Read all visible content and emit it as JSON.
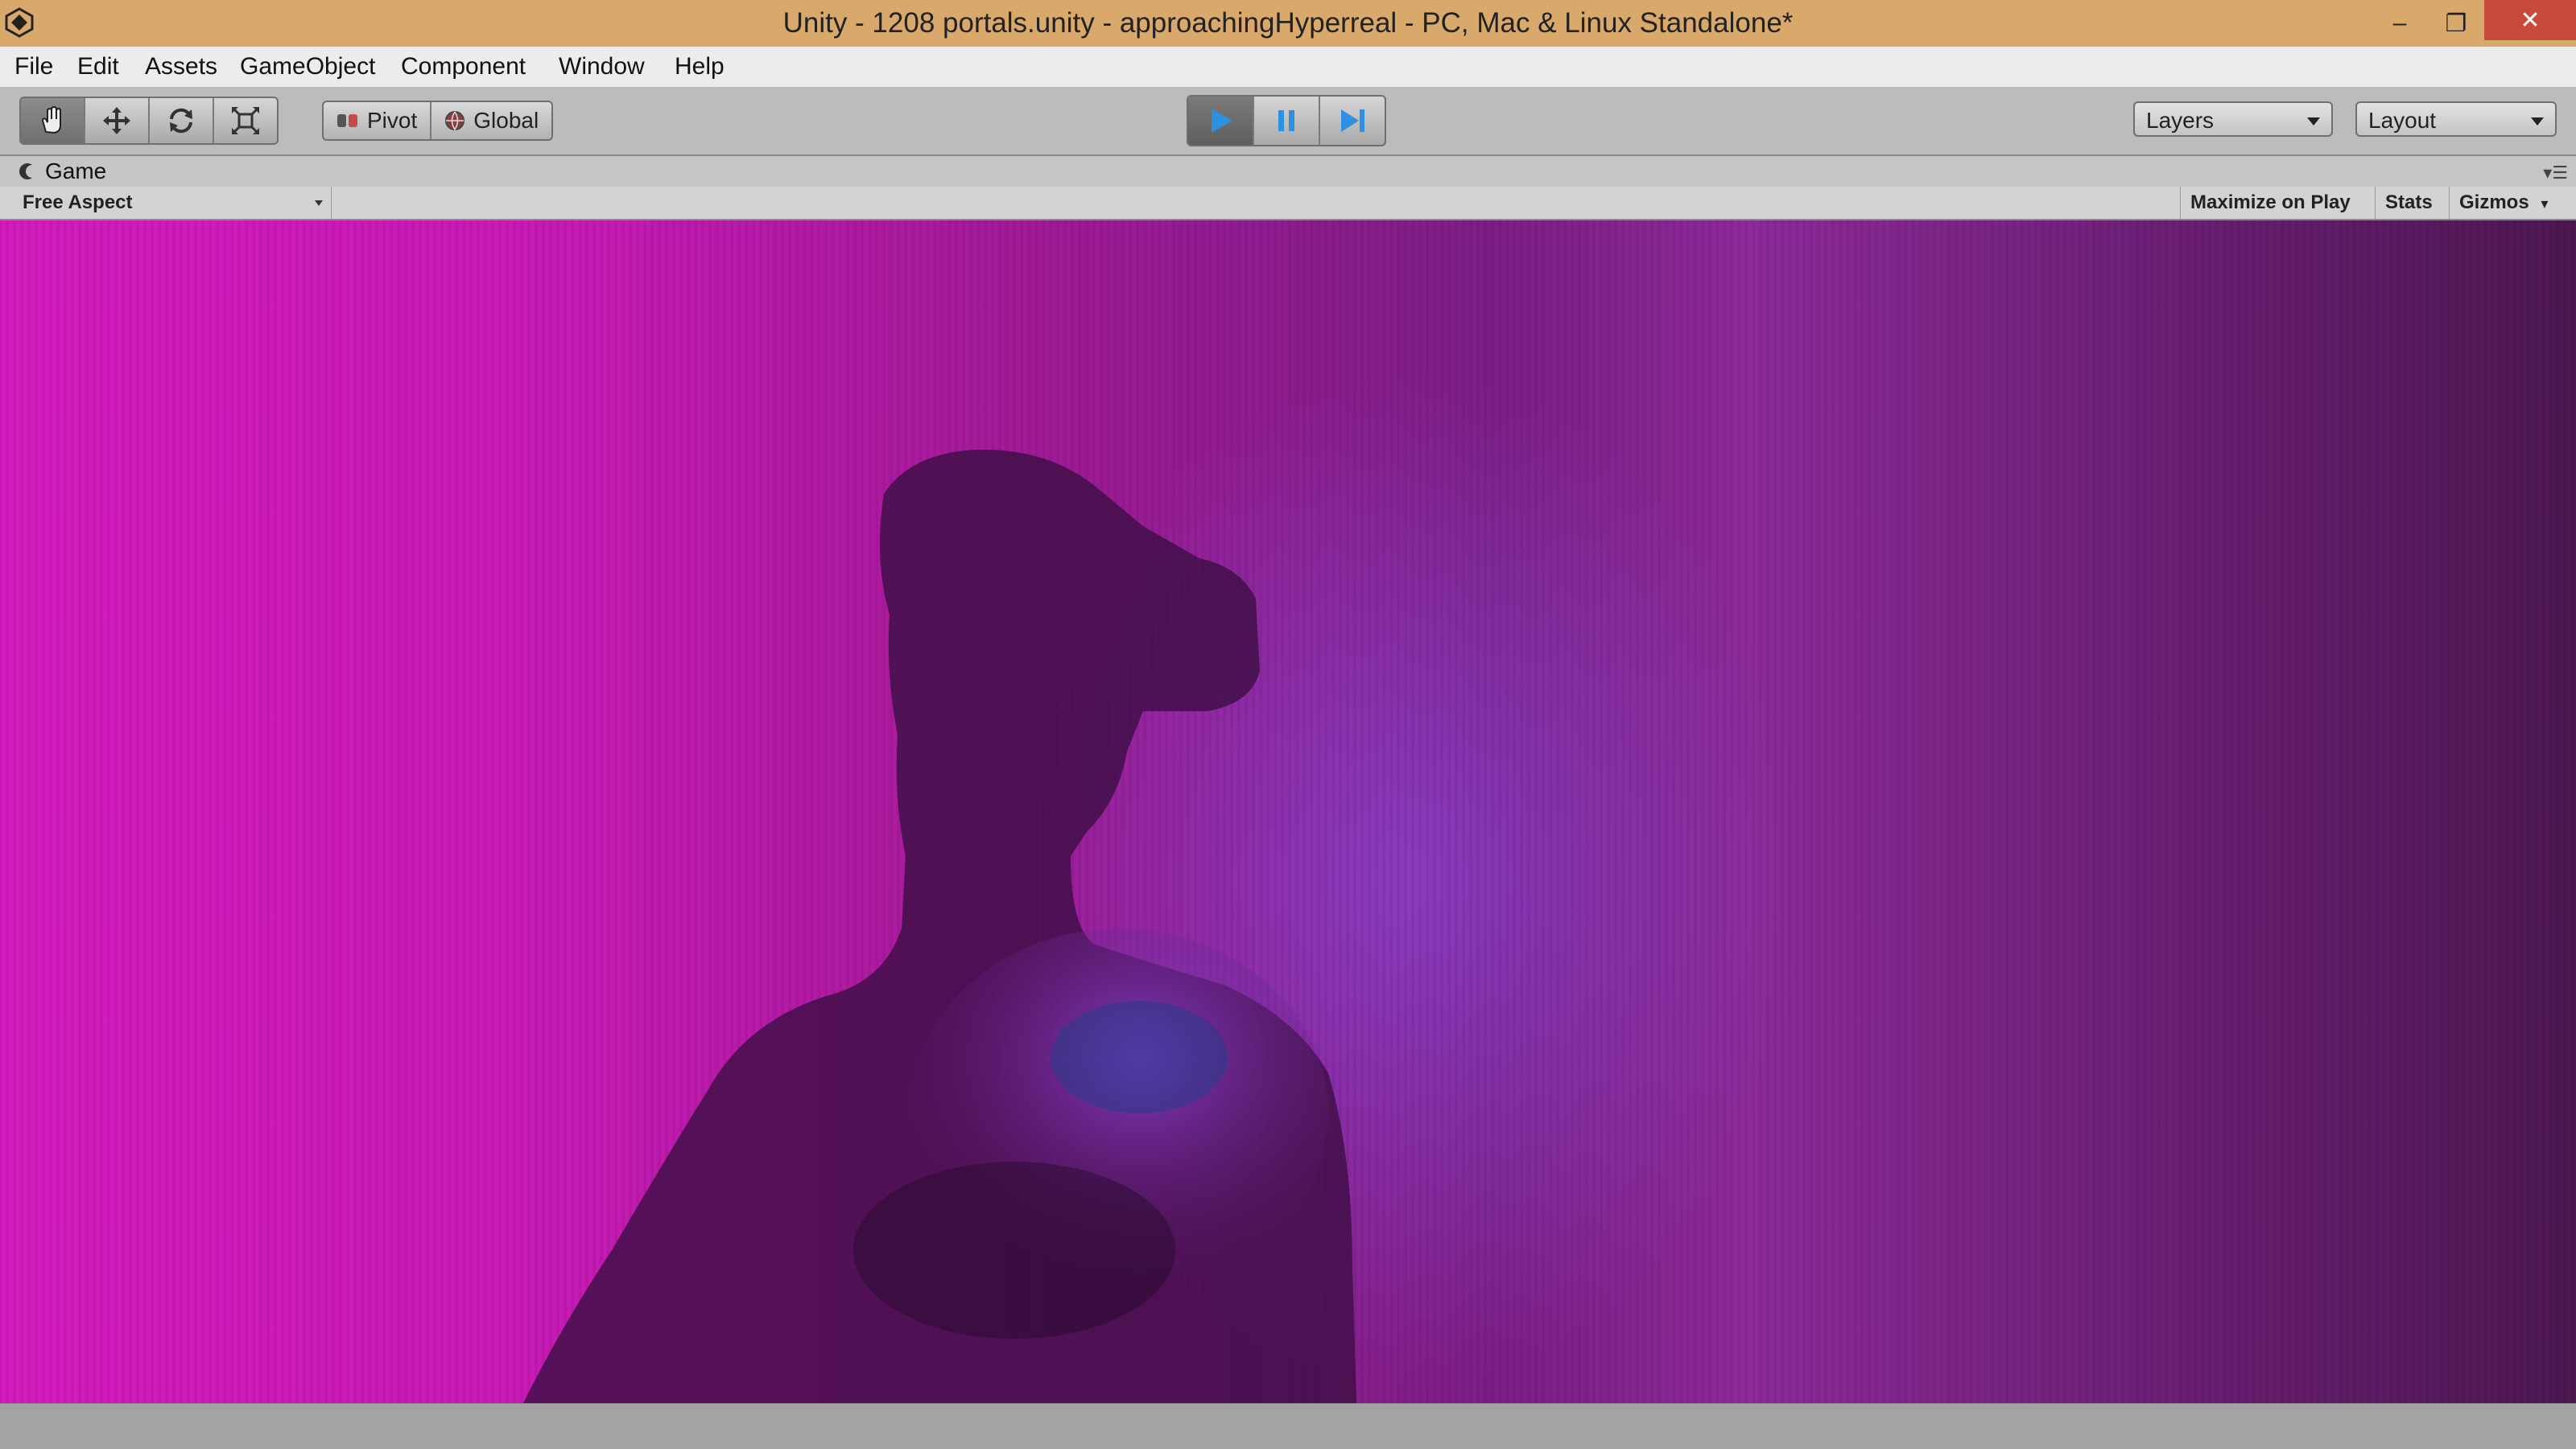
{
  "window": {
    "title": "Unity - 1208 portals.unity - approachingHyperreal - PC, Mac & Linux Standalone*",
    "minimize_glyph": "–",
    "maximize_glyph": "❐",
    "close_glyph": "✕"
  },
  "menu": {
    "items": [
      "File",
      "Edit",
      "Assets",
      "GameObject",
      "Component",
      "Window",
      "Help"
    ]
  },
  "toolbar": {
    "transform_tools": [
      "hand-icon",
      "move-icon",
      "rotate-icon",
      "scale-icon"
    ],
    "pivot_label": "Pivot",
    "global_label": "Global",
    "playback": [
      "play-icon",
      "pause-icon",
      "step-icon"
    ],
    "layers_label": "Layers",
    "layout_label": "Layout"
  },
  "game_panel": {
    "tab_label": "Game",
    "aspect_label": "Free Aspect",
    "maximize_on_play": "Maximize on Play",
    "stats": "Stats",
    "gizmos": "Gizmos"
  },
  "colors": {
    "titlebar": "#d9a96b",
    "close": "#c74a3b",
    "play_active": "#2f8fe0",
    "viewport_magenta": "#d61bbf",
    "viewport_purple": "#7d1e86"
  }
}
